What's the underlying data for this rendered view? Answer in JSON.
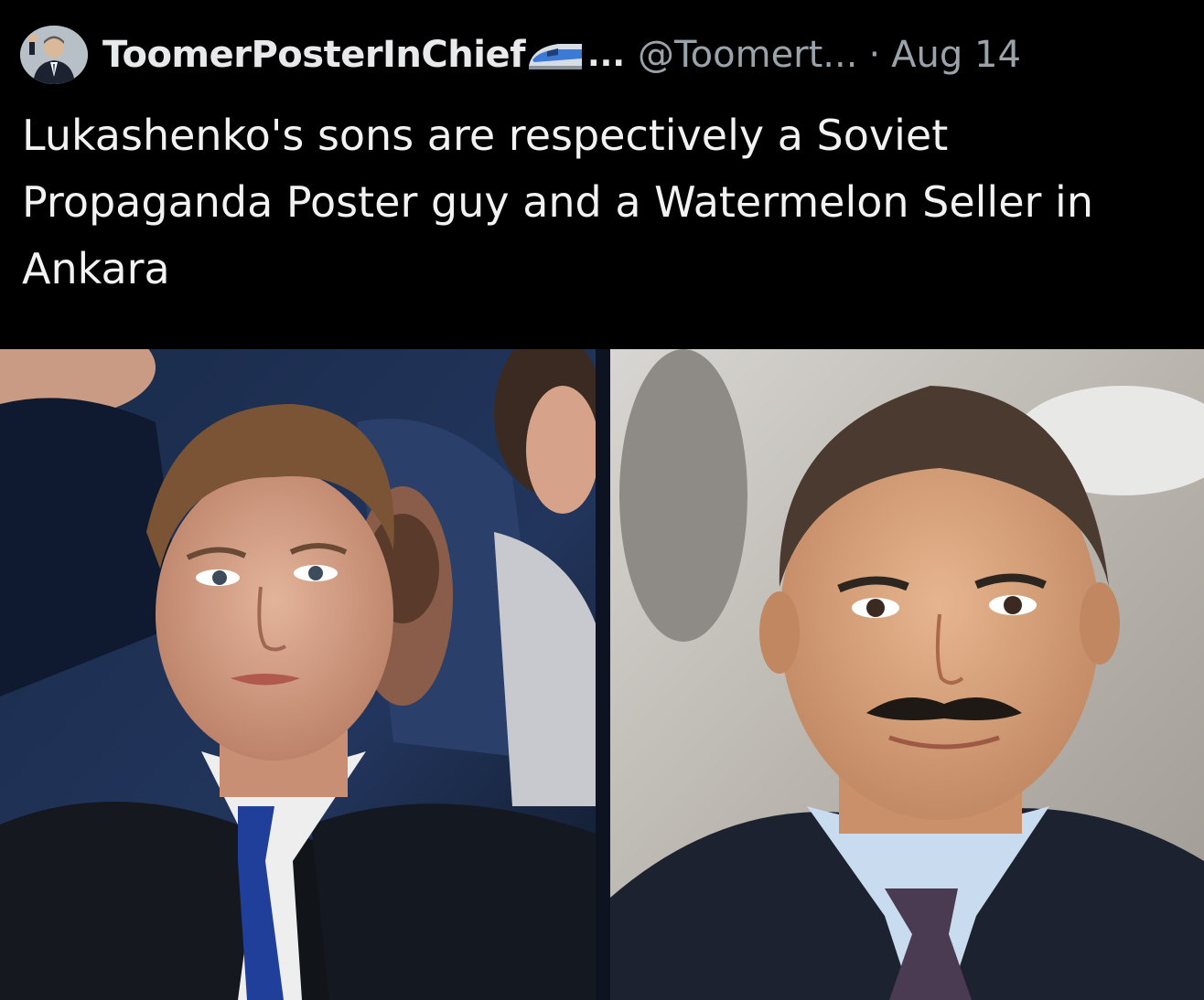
{
  "tweet": {
    "author": {
      "display_name": "ToomerPosterInChief",
      "display_emoji": "high-speed-train-emoji",
      "truncation": "...",
      "handle": "@Toomert...",
      "separator": "·",
      "timestamp": "Aug 14",
      "avatar_icon": "profile-avatar"
    },
    "text": "Lukashenko's sons are respectively a Soviet Propaganda Poster guy and a Watermelon Seller in Ankara",
    "media": [
      {
        "subject": "young-man-photo"
      },
      {
        "subject": "mustached-man-photo"
      }
    ]
  },
  "colors": {
    "background": "#000000",
    "primary_text": "#e7e9ea",
    "secondary_text": "#9aa3aa"
  }
}
